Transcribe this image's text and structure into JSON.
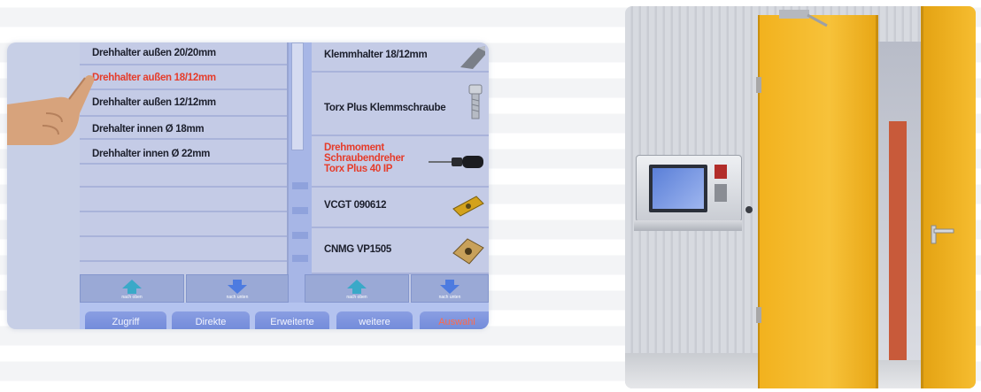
{
  "left_list": {
    "items": [
      {
        "label": "Drehhalter außen 20/20mm",
        "selected": false
      },
      {
        "label": "Drehhalter außen 18/12mm",
        "selected": true
      },
      {
        "label": "Drehhalter außen 12/12mm",
        "selected": false
      },
      {
        "label": "Drehalter innen Ø 18mm",
        "selected": false
      },
      {
        "label": "Drehhalter innen Ø 22mm",
        "selected": false
      }
    ]
  },
  "right_list": {
    "items": [
      {
        "label": "Klemmhalter 18/12mm",
        "icon": "clamp-holder-icon"
      },
      {
        "label": "Torx Plus Klemmschraube",
        "icon": "clamp-screw-icon"
      },
      {
        "label_lines": [
          "Drehmoment",
          "Schraubendreher",
          "Torx Plus 40 IP"
        ],
        "icon": "screwdriver-icon",
        "highlight": true
      },
      {
        "label": "VCGT 090612",
        "icon": "insert-rhombic-icon"
      },
      {
        "label": "CNMG VP1505",
        "icon": "insert-square-icon"
      }
    ]
  },
  "buttons": {
    "up_label": "nach oben",
    "down_label": "nach unten"
  },
  "tabs": [
    {
      "label": "Zugriff",
      "accent": false
    },
    {
      "label": "Direkte",
      "accent": false
    },
    {
      "label": "Erweiterte",
      "accent": false
    },
    {
      "label": "weitere",
      "accent": false
    },
    {
      "label": "Auswahl",
      "accent": true
    }
  ],
  "colors": {
    "list_bg": "#c4cbe6",
    "highlight_text": "#e63c2a",
    "door_yellow": "#f4b823",
    "arrow_teal": "#3aa9c8",
    "arrow_blue": "#4d7be0"
  }
}
